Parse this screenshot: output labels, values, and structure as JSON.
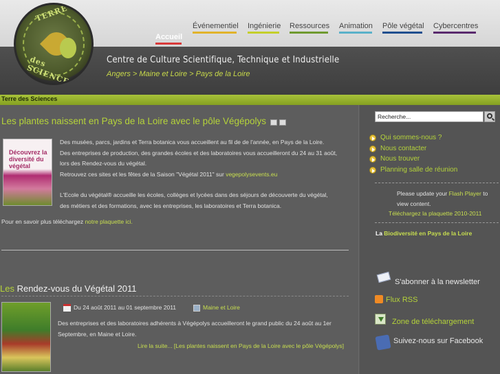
{
  "nav": {
    "items": [
      {
        "label": "Accueil",
        "color": "#d93a3a"
      },
      {
        "label": "Événementiel",
        "color": "#e1b32a"
      },
      {
        "label": "Ingénierie",
        "color": "#c4cf2a"
      },
      {
        "label": "Ressources",
        "color": "#6f9a2f"
      },
      {
        "label": "Animation",
        "color": "#5ab1c9"
      },
      {
        "label": "Pôle végétal",
        "color": "#1f4f8f"
      },
      {
        "label": "Cybercentres",
        "color": "#5a2a6e"
      }
    ]
  },
  "header": {
    "logo_top": "TERRE",
    "logo_bottom": "des SCIENCES",
    "site_title": "Centre de Culture Scientifique, Technique et Industrielle",
    "breadcrumb": "Angers > Maine et Loire > Pays de la Loire"
  },
  "section_label": "Terre des Sciences",
  "article1": {
    "title": "Les plantes naissent en Pays de la Loire avec le pôle Végépolys",
    "thumb_title": "Découvrez la diversité du végétal",
    "p1_line1": "Des musées, parcs, jardins et Terra botanica vous accueillent au fil de de l'année, en Pays de la Loire.",
    "p1_line2": "Des entreprises de production, des grandes écoles et des laboratoires vous accueilleront du 24 au 31 août,",
    "p1_line3": "lors des Rendez-vous du végétal.",
    "p1_line4_a": "Retrouvez ces sites et les fêtes de la  Saison \"Végétal 2011\"  sur ",
    "p1_line4_link": "vegepolysevents.eu",
    "p2_line1": "L'Ecole du végétal® accueille les écoles, collèges et lycées dans des séjours de découverte du végétal,",
    "p2_line2": "des métiers et des formations, avec les entreprises, les laboratoires et Terra botanica.",
    "p3_text": "Pour en savoir plus téléchargez ",
    "p3_link": "notre plaquette ici."
  },
  "article2": {
    "title_prefix": "Les",
    "title_rest": " Rendez-vous du Végétal 2011",
    "date": "Du 24 août 2011 au 01 septembre 2011",
    "location": "Maine et Loire",
    "p_line1": "Des entreprises et des laboratoires adhérents à Végépolys accueilleront le grand public du 24 août au 1er",
    "p_line2": "Septembre, en Maine et Loire.",
    "readmore": "Lire la suite... [Les plantes naissent en Pays de la Loire avec le pôle Végépolys]"
  },
  "sidebar": {
    "search_value": "Recherche...",
    "links": [
      "Qui sommes-nous ?",
      "Nous contacter",
      "Nous trouver",
      "Planning salle de réunion"
    ],
    "flash_line1_a": "Please update your ",
    "flash_line1_link": "Flash Player",
    "flash_line1_b": " to",
    "flash_line2": "view content.",
    "plaquette": "Téléchargez la plaquette 2010-2011",
    "biodiv_prefix": "La ",
    "biodiv_link": "Biodiversité en Pays de la Loire",
    "newsletter": "S'abonner à la newsletter",
    "rss": "Flux RSS",
    "download": "Zone de téléchargement",
    "facebook": "Suivez-nous sur Facebook"
  }
}
